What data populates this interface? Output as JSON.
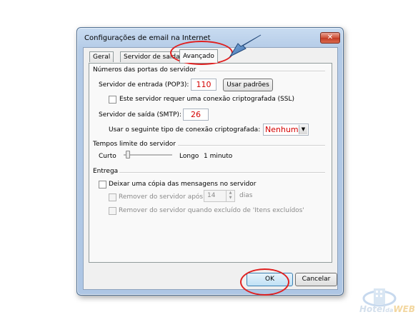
{
  "window": {
    "title": "Configurações de email na Internet",
    "close_glyph": "✕"
  },
  "tabs": [
    {
      "label": "Geral",
      "active": false
    },
    {
      "label": "Servidor de saída",
      "active": false
    },
    {
      "label": "Avançado",
      "active": true
    }
  ],
  "ports": {
    "group_label": "Números das portas do servidor",
    "incoming_label": "Servidor de entrada (POP3):",
    "incoming_value": "110",
    "use_defaults_button": "Usar padrões",
    "ssl_checkbox_label": "Este servidor requer uma conexão criptografada (SSL)",
    "ssl_checked": false,
    "outgoing_label": "Servidor de saída (SMTP):",
    "outgoing_value": "26",
    "encryption_label": "Usar o seguinte tipo de conexão criptografada:",
    "encryption_value": "Nenhum"
  },
  "timeouts": {
    "group_label": "Tempos limite do servidor",
    "short_label": "Curto",
    "long_label": "Longo",
    "value_label": "1 minuto",
    "slider_level": 0.05
  },
  "delivery": {
    "group_label": "Entrega",
    "leave_copy_label": "Deixar uma cópia das mensagens no servidor",
    "leave_copy_checked": false,
    "remove_after_label": "Remover do servidor após",
    "remove_after_value": "14",
    "days_label": "dias",
    "remove_deleted_label": "Remover do servidor quando excluído de 'Itens excluídos'"
  },
  "footer": {
    "ok_label": "OK",
    "cancel_label": "Cancelar"
  },
  "watermark": {
    "text_a": "Hotel",
    "text_b": "da",
    "text_c": "WEB"
  },
  "colors": {
    "annotation_red": "#e02020",
    "value_red": "#d40000",
    "arrow_blue": "#3a6fb0"
  }
}
